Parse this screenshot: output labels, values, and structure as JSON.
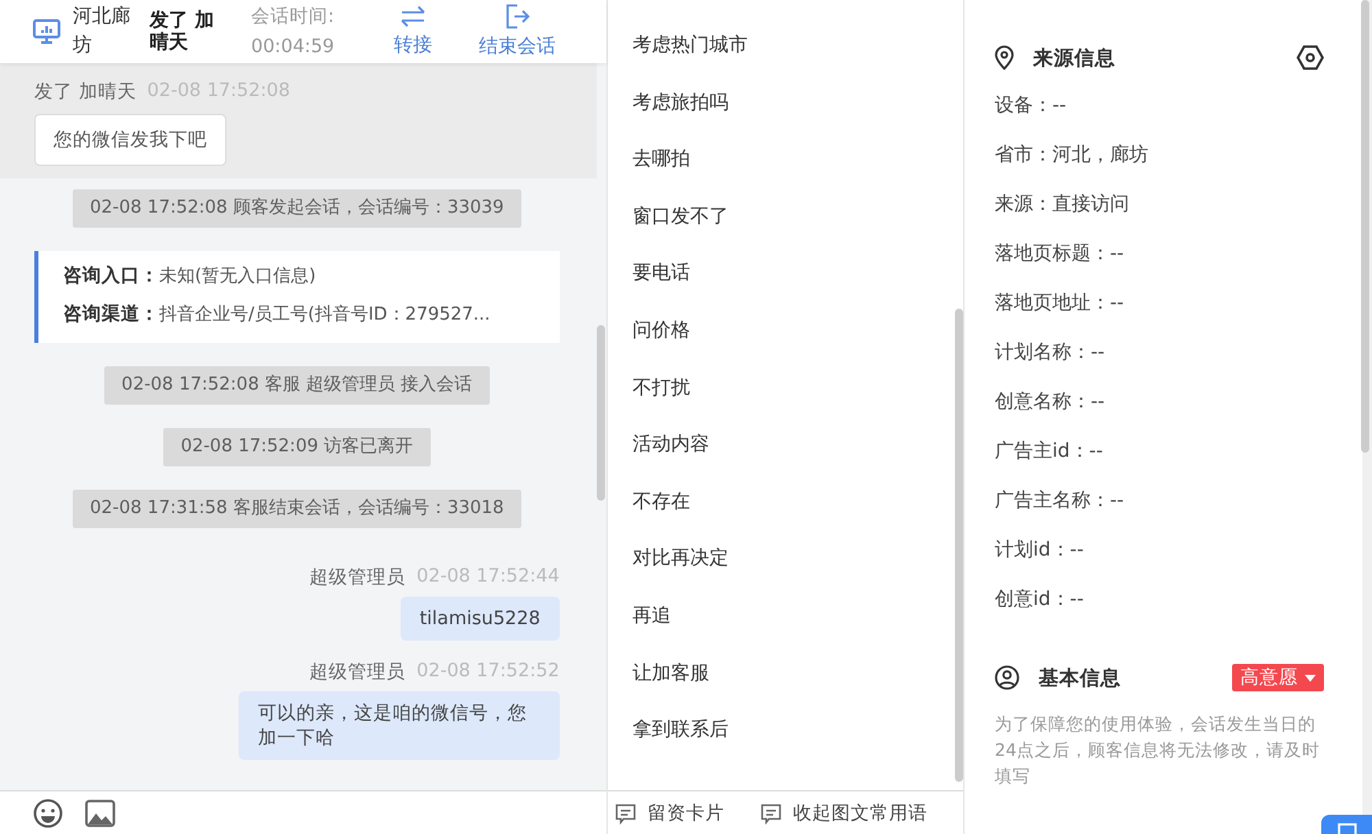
{
  "header": {
    "location": "河北廊坊",
    "visitor": "发了 加晴天",
    "duration_label": "会话时间:",
    "duration": "00:04:59",
    "actions": [
      {
        "label": "转接",
        "kind": "transfer"
      },
      {
        "label": "结束会话",
        "kind": "end"
      }
    ]
  },
  "pinned_message": {
    "sender": "发了 加晴天",
    "time": "02-08 17:52:08",
    "text": "您的微信发我下吧"
  },
  "messages": [
    {
      "kind": "system",
      "text": "02-08 17:52:08 顾客发起会话，会话编号：33039"
    },
    {
      "kind": "info",
      "rows": [
        {
          "label": "咨询入口：",
          "value": "未知(暂无入口信息)"
        },
        {
          "label": "咨询渠道：",
          "value": "抖音企业号/员工号(抖音号ID：279527..."
        }
      ]
    },
    {
      "kind": "system",
      "text": "02-08 17:52:08 客服 超级管理员 接入会话"
    },
    {
      "kind": "system",
      "text": "02-08 17:52:09 访客已离开"
    },
    {
      "kind": "system",
      "text": "02-08 17:31:58 客服结束会话，会话编号：33018"
    },
    {
      "kind": "agent",
      "sender": "超级管理员",
      "time": "02-08 17:52:44",
      "text": "tilamisu5228"
    },
    {
      "kind": "agent",
      "sender": "超级管理员",
      "time": "02-08 17:52:52",
      "text": "可以的亲，这是咱的微信号，您加一下哈"
    }
  ],
  "composer_tools": [
    {
      "kind": "emoji"
    },
    {
      "kind": "image"
    }
  ],
  "quick_replies": [
    "考虑热门城市",
    "考虑旅拍吗",
    "去哪拍",
    "窗口发不了",
    "要电话",
    "问价格",
    "不打扰",
    "活动内容",
    "不存在",
    "对比再决定",
    "再追",
    "让加客服",
    "拿到联系后"
  ],
  "quick_reply_actions": [
    "留资卡片",
    "收起图文常用语"
  ],
  "source_info": {
    "title": "来源信息",
    "fields": [
      "设备：--",
      "省市：河北，廊坊",
      "来源：直接访问",
      "落地页标题：--",
      "落地页地址：--",
      "计划名称：--",
      "创意名称：--",
      "广告主id：--",
      "广告主名称：--",
      "计划id：--",
      "创意id：--"
    ]
  },
  "basic_info": {
    "title": "基本信息",
    "intent_tag": "高意愿",
    "notice": "为了保障您的使用体验，会话发生当日的24点之后，顾客信息将无法修改，请及时填写"
  }
}
